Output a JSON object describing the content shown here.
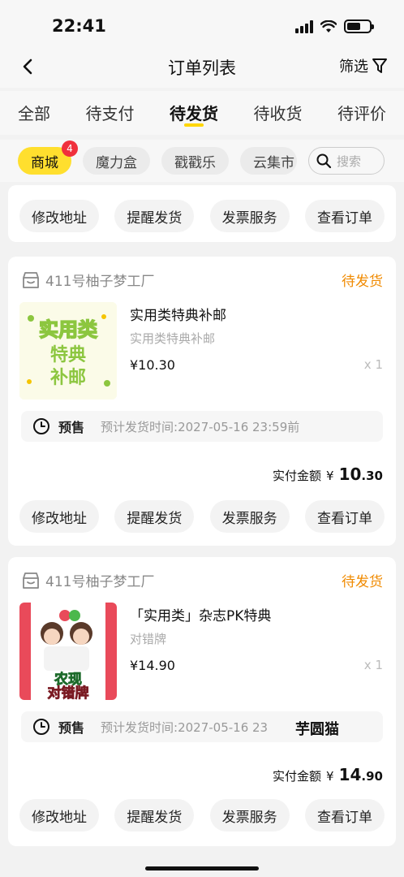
{
  "status_bar": {
    "time": "22:41"
  },
  "header": {
    "title": "订单列表",
    "filter_label": "筛选"
  },
  "tabs": [
    {
      "label": "全部"
    },
    {
      "label": "待支付"
    },
    {
      "label": "待发货"
    },
    {
      "label": "待收货"
    },
    {
      "label": "待评价"
    }
  ],
  "chips": [
    {
      "label": "商城",
      "badge": "4"
    },
    {
      "label": "魔力盒"
    },
    {
      "label": "戳戳乐"
    },
    {
      "label": "云集市"
    }
  ],
  "search": {
    "placeholder": "搜索"
  },
  "order_actions": {
    "change_address": "修改地址",
    "remind_ship": "提醒发货",
    "invoice": "发票服务",
    "view_order": "查看订单"
  },
  "orders": [
    {
      "shop": "411号柚子梦工厂",
      "status": "待发货",
      "product_name": "实用类特典补邮",
      "product_sub": "实用类特典补邮",
      "price": "¥10.30",
      "qty": "x 1",
      "presale_label": "预售",
      "eta": "预计发货时间:2027-05-16 23:59前",
      "total_label": "实付金额",
      "total_currency": "¥",
      "total_int": "10",
      "total_dec": ".30",
      "thumb_text_1": "实用类",
      "thumb_text_2": "特典",
      "thumb_text_3": "补邮"
    },
    {
      "shop": "411号柚子梦工厂",
      "status": "待发货",
      "product_name": "「实用类」杂志PK特典",
      "product_sub": "对错牌",
      "price": "¥14.90",
      "qty": "x 1",
      "presale_label": "预售",
      "eta": "预计发货时间:2027-05-16 23",
      "total_label": "实付金额",
      "total_currency": "¥",
      "total_int": "14",
      "total_dec": ".90",
      "thumb_text_1": "农现",
      "thumb_text_2": "对错牌"
    }
  ],
  "overlay_text": "芋圆猫"
}
